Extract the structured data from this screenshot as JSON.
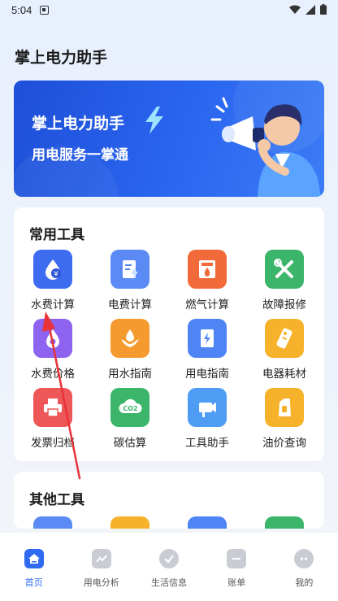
{
  "status": {
    "time": "5:04"
  },
  "app_title": "掌上电力助手",
  "banner": {
    "line1": "掌上电力助手",
    "line2": "用电服务一掌通"
  },
  "tools": {
    "title": "常用工具",
    "items": [
      {
        "label": "水费计算",
        "icon": "water-drop-yen-icon",
        "color": "#3d6cf0"
      },
      {
        "label": "电费计算",
        "icon": "bill-bolt-icon",
        "color": "#5b8af5"
      },
      {
        "label": "燃气计算",
        "icon": "gas-meter-icon",
        "color": "#f36a3a"
      },
      {
        "label": "故障报修",
        "icon": "repair-tools-icon",
        "color": "#3bb56a"
      },
      {
        "label": "水费价格",
        "icon": "water-price-icon",
        "color": "#8e63f0"
      },
      {
        "label": "用水指南",
        "icon": "water-hands-icon",
        "color": "#f59a2f"
      },
      {
        "label": "用电指南",
        "icon": "power-guide-icon",
        "color": "#4f84f5"
      },
      {
        "label": "电器耗材",
        "icon": "remote-battery-icon",
        "color": "#f6b22a"
      },
      {
        "label": "发票归档",
        "icon": "printer-icon",
        "color": "#ee5757"
      },
      {
        "label": "碳估算",
        "icon": "co2-cloud-icon",
        "color": "#3bb56a"
      },
      {
        "label": "工具助手",
        "icon": "camera-tool-icon",
        "color": "#4f9cf5"
      },
      {
        "label": "油价查询",
        "icon": "oil-can-icon",
        "color": "#f6b22a"
      }
    ]
  },
  "other_tools": {
    "title": "其他工具",
    "peek_colors": [
      "#5b8af5",
      "#f6b22a",
      "#4f84f5",
      "#3bb56a"
    ]
  },
  "tabbar": [
    {
      "label": "首页",
      "icon": "home-icon",
      "active": true
    },
    {
      "label": "用电分析",
      "icon": "chart-icon",
      "active": false
    },
    {
      "label": "生活信息",
      "icon": "check-circle-icon",
      "active": false
    },
    {
      "label": "账单",
      "icon": "bill-icon",
      "active": false
    },
    {
      "label": "我的",
      "icon": "profile-icon",
      "active": false
    }
  ],
  "colors": {
    "accent": "#2f6bf2",
    "banner": "#2a66f0",
    "annotation_arrow": "#e8333a"
  }
}
